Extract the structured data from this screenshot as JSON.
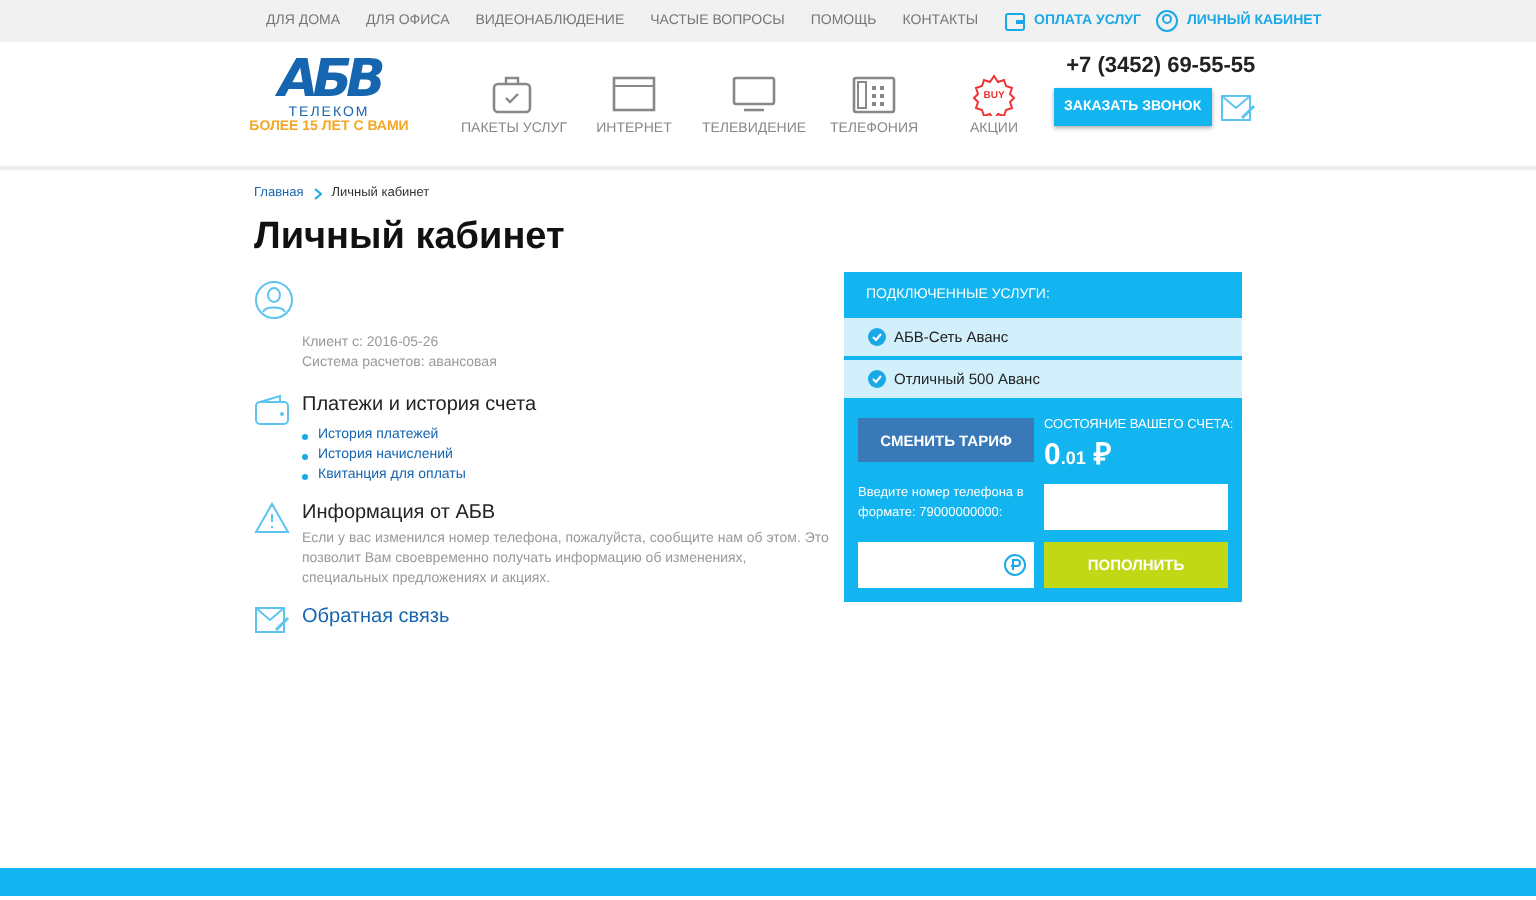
{
  "top_nav": {
    "links": [
      "ДЛЯ ДОМА",
      "ДЛЯ ОФИСА",
      "ВИДЕОНАБЛЮДЕНИЕ",
      "ЧАСТЫЕ ВОПРОСЫ",
      "ПОМОЩЬ",
      "КОНТАКТЫ"
    ],
    "pay": "ОПЛАТА УСЛУГ",
    "cabinet": "ЛИЧНЫЙ КАБИНЕТ"
  },
  "header": {
    "logo": "АБВ",
    "logo_sub": "ТЕЛЕКОМ",
    "tagline": "БОЛЕЕ 15 ЛЕТ С ВАМИ",
    "nav": [
      {
        "kind": "package",
        "label": "ПАКЕТЫ УСЛУГ"
      },
      {
        "kind": "internet",
        "label": "ИНТЕРНЕТ"
      },
      {
        "kind": "tv",
        "label": "ТЕЛЕВИДЕНИЕ"
      },
      {
        "kind": "phone",
        "label": "ТЕЛЕФОНИЯ"
      },
      {
        "kind": "sale",
        "label": "АКЦИИ",
        "badge": "BUY"
      }
    ],
    "phone": "+7 (3452) 69-55-55",
    "callback": "ЗАКАЗАТЬ ЗВОНОК"
  },
  "breadcrumbs": [
    "Главная",
    "Личный кабинет"
  ],
  "title": "Личный кабинет",
  "client": {
    "since": "Клиент с: 2016-05-26",
    "billing": "Система расчетов: авансовая"
  },
  "payments": {
    "heading": "Платежи и история счета",
    "links": [
      "История платежей",
      "История начислений",
      "Квитанция для оплаты"
    ]
  },
  "info": {
    "heading": "Информация от АБВ",
    "text": "Если у вас изменился номер телефона, пожалуйста, сообщите нам об этом. Это позволит Вам своевременно получать информацию об изменениях, специальных предложениях и акциях."
  },
  "feedback": "Обратная связь",
  "panel": {
    "heading": "ПОДКЛЮЧЕННЫЕ УСЛУГИ:",
    "services": [
      "АБВ-Сеть Аванс",
      "Отличный 500 Аванс"
    ],
    "change": "СМЕНИТЬ ТАРИФ",
    "balance_label": "СОСТОЯНИЕ ВАШЕГО СЧЕТА:",
    "balance_int": "0",
    "balance_frac": ".01",
    "currency": "₽",
    "prompt": "Введите номер телефона в формате: 79000000000:",
    "topup": "ПОПОЛНИТЬ"
  }
}
